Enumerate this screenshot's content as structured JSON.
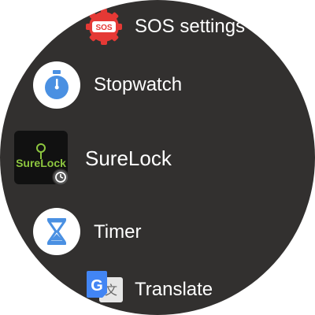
{
  "apps": [
    {
      "label": "SOS settings",
      "icon": "sos-settings-icon",
      "badge_text": "SOS",
      "icon_color": "#e53935"
    },
    {
      "label": "Stopwatch",
      "icon": "stopwatch-icon",
      "icon_color": "#4a90e2"
    },
    {
      "label": "SureLock",
      "icon": "surelock-icon",
      "icon_text": "SureLock",
      "badge": "clock-badge-icon",
      "icon_color": "#8dc63f"
    },
    {
      "label": "Timer",
      "icon": "hourglass-icon",
      "icon_color": "#4a90e2"
    },
    {
      "label": "Translate",
      "icon": "google-translate-icon",
      "icon_text_front": "G",
      "icon_text_back": "文",
      "icon_color": "#4285f4"
    }
  ]
}
